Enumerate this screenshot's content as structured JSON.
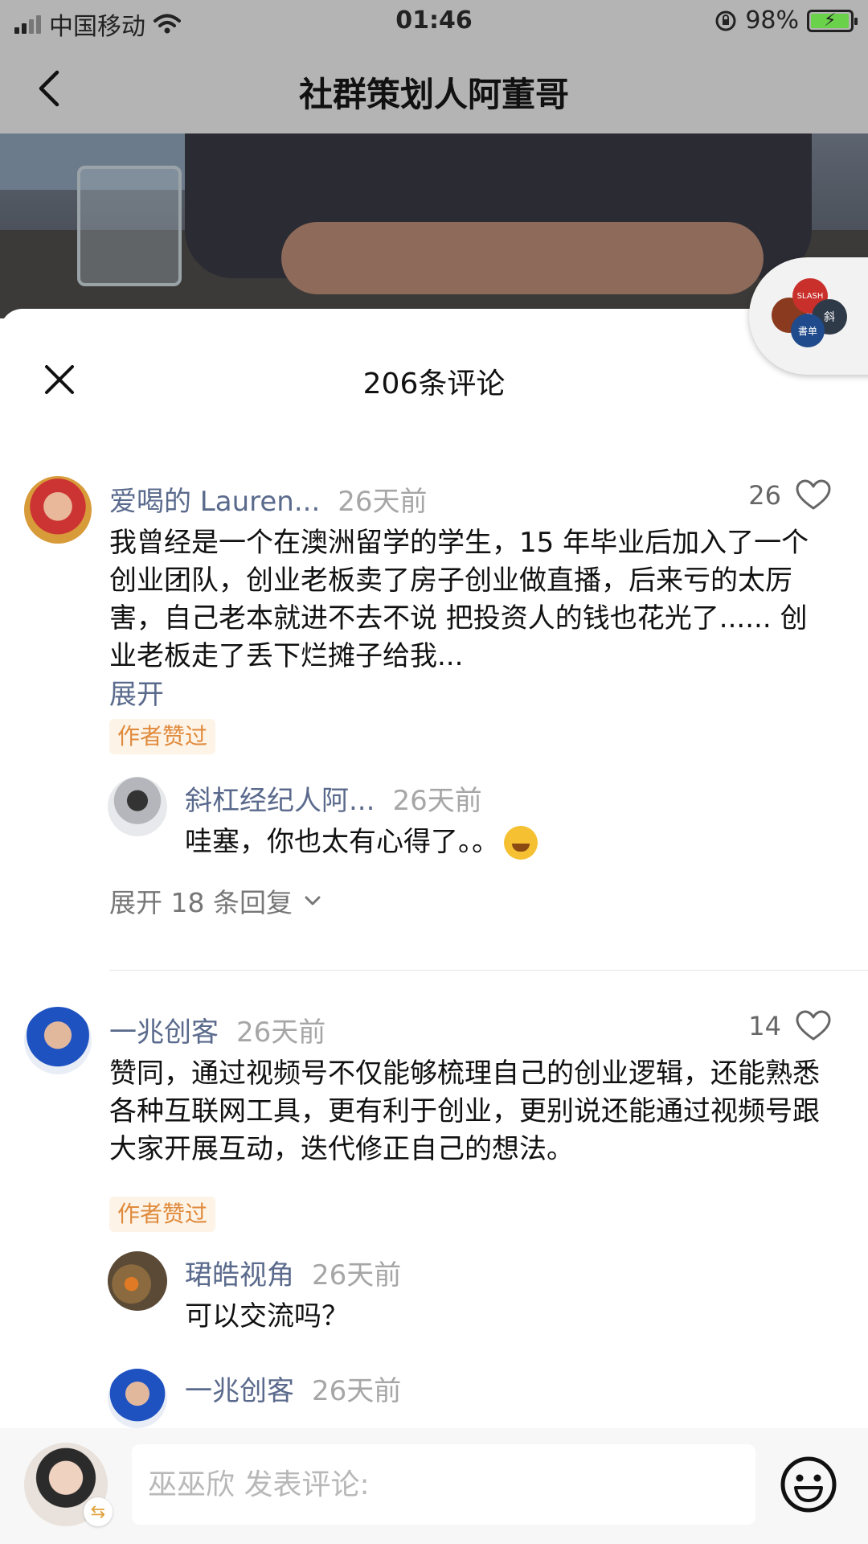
{
  "status_bar": {
    "carrier": "中国移动",
    "time": "01:46",
    "battery_percent": "98%",
    "battery_level": 0.98
  },
  "nav": {
    "title": "社群策划人阿董哥"
  },
  "float_badge": {
    "label_top": "SLASH",
    "label_mid": "斜",
    "label_bottom": "書单"
  },
  "sheet": {
    "title": "206条评论"
  },
  "comments": [
    {
      "name": "爱喝的 Lauren...",
      "time": "26天前",
      "likes": "26",
      "body": "我曾经是一个在澳洲留学的学生，15 年毕业后加入了一个创业团队，创业老板卖了房子创业做直播，后来亏的太厉害，自己老本就进不去不说 把投资人的钱也花光了...... 创业老板走了丢下烂摊子给我...",
      "expand": "展开",
      "tag": "作者赞过",
      "reply": {
        "name": "斜杠经纪人阿...",
        "time": "26天前",
        "body": "哇塞，你也太有心得了。。"
      },
      "more_replies": "展开 18 条回复"
    },
    {
      "name": "一兆创客",
      "time": "26天前",
      "likes": "14",
      "body": "赞同，通过视频号不仅能够梳理自己的创业逻辑，还能熟悉各种互联网工具，更有利于创业，更别说还能通过视频号跟大家开展互动，迭代修正自己的想法。",
      "tag": "作者赞过",
      "replies": [
        {
          "name": "珺皓视角",
          "time": "26天前",
          "body": "可以交流吗？"
        },
        {
          "name": "一兆创客",
          "time": "26天前",
          "body": ""
        }
      ]
    }
  ],
  "input": {
    "placeholder": "巫巫欣 发表评论:"
  },
  "colors": {
    "name_link": "#5a6a8c",
    "tag_text": "#e08a3c",
    "tag_bg": "#fdf3e6"
  }
}
